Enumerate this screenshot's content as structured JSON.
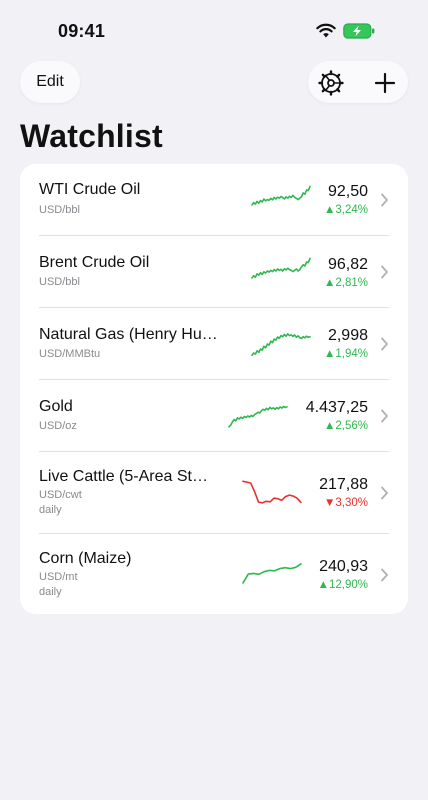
{
  "status_bar": {
    "time": "09:41"
  },
  "toolbar": {
    "edit_label": "Edit"
  },
  "page": {
    "title": "Watchlist"
  },
  "colors": {
    "up": "#2fb84f",
    "down": "#e5312b"
  },
  "items": [
    {
      "name": "WTI Crude Oil",
      "unit": "USD/bbl",
      "frequency": "",
      "price": "92,50",
      "change": "▲3,24%",
      "direction": "up",
      "spark": [
        0.3,
        0.38,
        0.33,
        0.42,
        0.36,
        0.45,
        0.4,
        0.5,
        0.44,
        0.48,
        0.46,
        0.52,
        0.47,
        0.55,
        0.5,
        0.56,
        0.53,
        0.58,
        0.55,
        0.5,
        0.57,
        0.53,
        0.59,
        0.55,
        0.62,
        0.56,
        0.52,
        0.48,
        0.53,
        0.58,
        0.7,
        0.66,
        0.8,
        0.78,
        0.92
      ]
    },
    {
      "name": "Brent Crude Oil",
      "unit": "USD/bbl",
      "frequency": "",
      "price": "96,82",
      "change": "▲2,81%",
      "direction": "up",
      "spark": [
        0.25,
        0.33,
        0.28,
        0.4,
        0.35,
        0.44,
        0.38,
        0.47,
        0.43,
        0.5,
        0.46,
        0.52,
        0.48,
        0.55,
        0.5,
        0.57,
        0.52,
        0.56,
        0.5,
        0.58,
        0.54,
        0.6,
        0.55,
        0.52,
        0.48,
        0.53,
        0.57,
        0.5,
        0.55,
        0.65,
        0.72,
        0.68,
        0.82,
        0.8,
        0.95
      ]
    },
    {
      "name": "Natural Gas (Henry Hu…",
      "unit": "USD/MMBtu",
      "frequency": "",
      "price": "2,998",
      "change": "▲1,94%",
      "direction": "up",
      "spark": [
        0.1,
        0.18,
        0.14,
        0.26,
        0.2,
        0.32,
        0.28,
        0.42,
        0.36,
        0.5,
        0.46,
        0.6,
        0.55,
        0.68,
        0.64,
        0.75,
        0.7,
        0.8,
        0.76,
        0.84,
        0.78,
        0.86,
        0.8,
        0.83,
        0.77,
        0.82,
        0.74,
        0.79,
        0.72,
        0.7,
        0.76,
        0.72,
        0.78,
        0.74,
        0.76
      ]
    },
    {
      "name": "Gold",
      "unit": "USD/oz",
      "frequency": "",
      "price": "4.437,25",
      "change": "▲2,56%",
      "direction": "up",
      "spark": [
        0.05,
        0.12,
        0.25,
        0.35,
        0.3,
        0.42,
        0.38,
        0.45,
        0.4,
        0.48,
        0.44,
        0.5,
        0.46,
        0.52,
        0.48,
        0.56,
        0.6,
        0.66,
        0.62,
        0.72,
        0.78,
        0.74,
        0.82,
        0.76,
        0.86,
        0.8,
        0.84,
        0.78,
        0.85,
        0.8,
        0.88,
        0.83,
        0.9,
        0.86,
        0.88
      ]
    },
    {
      "name": "Live Cattle (5-Area St…",
      "unit": "USD/cwt",
      "frequency": "daily",
      "price": "217,88",
      "change": "▼3,30%",
      "direction": "down",
      "spark": [
        0.95,
        0.92,
        0.88,
        0.55,
        0.15,
        0.12,
        0.18,
        0.16,
        0.3,
        0.28,
        0.22,
        0.36,
        0.42,
        0.38,
        0.3,
        0.14
      ]
    },
    {
      "name": "Corn (Maize)",
      "unit": "USD/mt",
      "frequency": "daily",
      "price": "240,93",
      "change": "▲12,90%",
      "direction": "up",
      "spark": [
        0.05,
        0.45,
        0.48,
        0.44,
        0.56,
        0.62,
        0.6,
        0.7,
        0.74,
        0.7,
        0.76,
        0.92
      ]
    }
  ]
}
